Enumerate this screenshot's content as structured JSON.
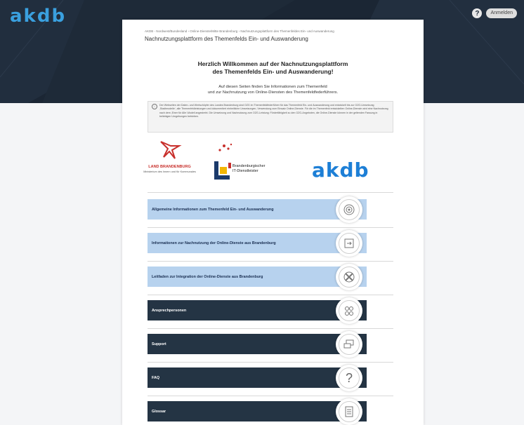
{
  "header": {
    "brand": "akdb",
    "help_icon": "help-icon",
    "login_label": "Anmelden"
  },
  "breadcrumb": "AKDB - Nordwest/Bundesland  ›  Online-Dienste/Mitte Brandenburg  ›  Nachnutzungsplattform des Themenfeldes Ein- und Auswanderung",
  "page_title": "Nachnutzungsplattform des Themenfelds Ein- und Auswanderung",
  "welcome": {
    "line1": "Herzlich Willkommen auf der Nachnutzungsplattform",
    "line2": "des Themenfelds Ein- und Auswanderung!"
  },
  "intro": {
    "line1": "Auf diesen Seiten finden Sie Informationen zum Themenfeld",
    "line2": "und zur Nachnutzung von Online-Diensten des Themenfeldfederführers."
  },
  "notice": "Der Webseiten der Daten- und Wertschöpfer des Landes Brandenburg sind OZG im Themenfeldfederführer für das Themenfeld Ein- und Auswanderung und entwickelt bis zur OZG-Umsetzung ‚Stadtmodelle‘, alle Themenfeldleistungen und dokumentiert einheitliche Umsetzungen, Verwendung zum Einsatz Online-Dienste. Für die im Themenfeld entwickelten Online-Dienste wird eine Nachnutzung nach dem ‚Einer für Alle‘-Modell angestrebt. Die Umsetzung und Nachnutzung zum OZG-Leistung: Förderfähigkeit zu den OZG-Angeboten, die Online-Dienste können in der geltenden Fassung in beliebigen Umgebungen betrieben.",
  "logos": {
    "land_brandenburg": "LAND BRANDENBURG",
    "ministry": "Ministerium des Innern und für Kommunales",
    "itd_line1": "Brandenburgischer",
    "itd_line2": "IT-Dienstleister",
    "akdb": "akdb"
  },
  "nav": [
    {
      "label": "Allgemeine Informationen zum Themenfeld Ein- und Auswanderung",
      "style": "light",
      "icon": "target-icon"
    },
    {
      "label": "Informationen zur Nachnutzung der Online-Dienste aus Brandenburg",
      "style": "light",
      "icon": "exchange-icon"
    },
    {
      "label": "Leitfaden zur Integration der Online-Dienste aus Brandenburg",
      "style": "light",
      "icon": "tools-icon"
    },
    {
      "label": "Ansprechpersonen",
      "style": "dark",
      "icon": "people-icon"
    },
    {
      "label": "Support",
      "style": "dark",
      "icon": "chat-icon"
    },
    {
      "label": "FAQ",
      "style": "dark",
      "icon": "question-icon"
    },
    {
      "label": "Glossar",
      "style": "dark",
      "icon": "document-icon"
    }
  ],
  "colors": {
    "header_bg": "#1b2634",
    "brand_blue": "#3aa0df",
    "nav_light": "#b7d2ee",
    "nav_dark": "#243444",
    "land_red": "#c8302c",
    "akdb_blue": "#1d7fd6"
  }
}
